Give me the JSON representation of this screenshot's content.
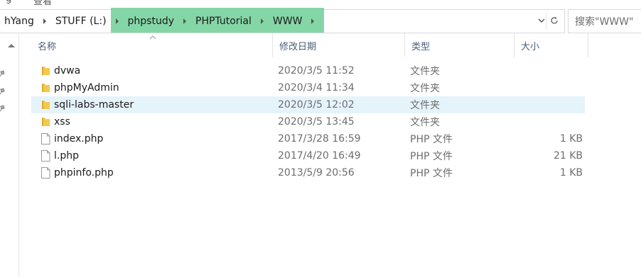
{
  "ribbon_fragments": [
    "ɡ",
    "查看"
  ],
  "address": {
    "crumbs": [
      "hYang",
      "STUFF (L:)",
      "phpstudy",
      "PHPTutorial",
      "WWW"
    ],
    "dropdown_icon": "chevron-down-icon",
    "refresh_icon": "refresh-icon"
  },
  "search": {
    "placeholder": "搜索\"WWW\""
  },
  "columns": {
    "name": "名称",
    "date": "修改日期",
    "type": "类型",
    "size": "大小"
  },
  "files": [
    {
      "name": "dvwa",
      "date": "2020/3/5 11:52",
      "type": "文件夹",
      "size": "",
      "icon": "folder-icon"
    },
    {
      "name": "phpMyAdmin",
      "date": "2020/3/4 11:34",
      "type": "文件夹",
      "size": "",
      "icon": "folder-icon"
    },
    {
      "name": "sqli-labs-master",
      "date": "2020/3/5 12:02",
      "type": "文件夹",
      "size": "",
      "icon": "folder-icon",
      "selected": true
    },
    {
      "name": "xss",
      "date": "2020/3/5 13:45",
      "type": "文件夹",
      "size": "",
      "icon": "folder-icon"
    },
    {
      "name": "index.php",
      "date": "2017/3/28 16:59",
      "type": "PHP 文件",
      "size": "1 KB",
      "icon": "file-icon"
    },
    {
      "name": "l.php",
      "date": "2017/4/20 16:49",
      "type": "PHP 文件",
      "size": "21 KB",
      "icon": "file-icon"
    },
    {
      "name": "phpinfo.php",
      "date": "2013/5/9 20:56",
      "type": "PHP 文件",
      "size": "1 KB",
      "icon": "file-icon"
    }
  ],
  "colors": {
    "highlight": "#6fcf97",
    "selection": "#e5f3fb",
    "header_text": "#4c607a",
    "folder": "#f2c94c"
  }
}
